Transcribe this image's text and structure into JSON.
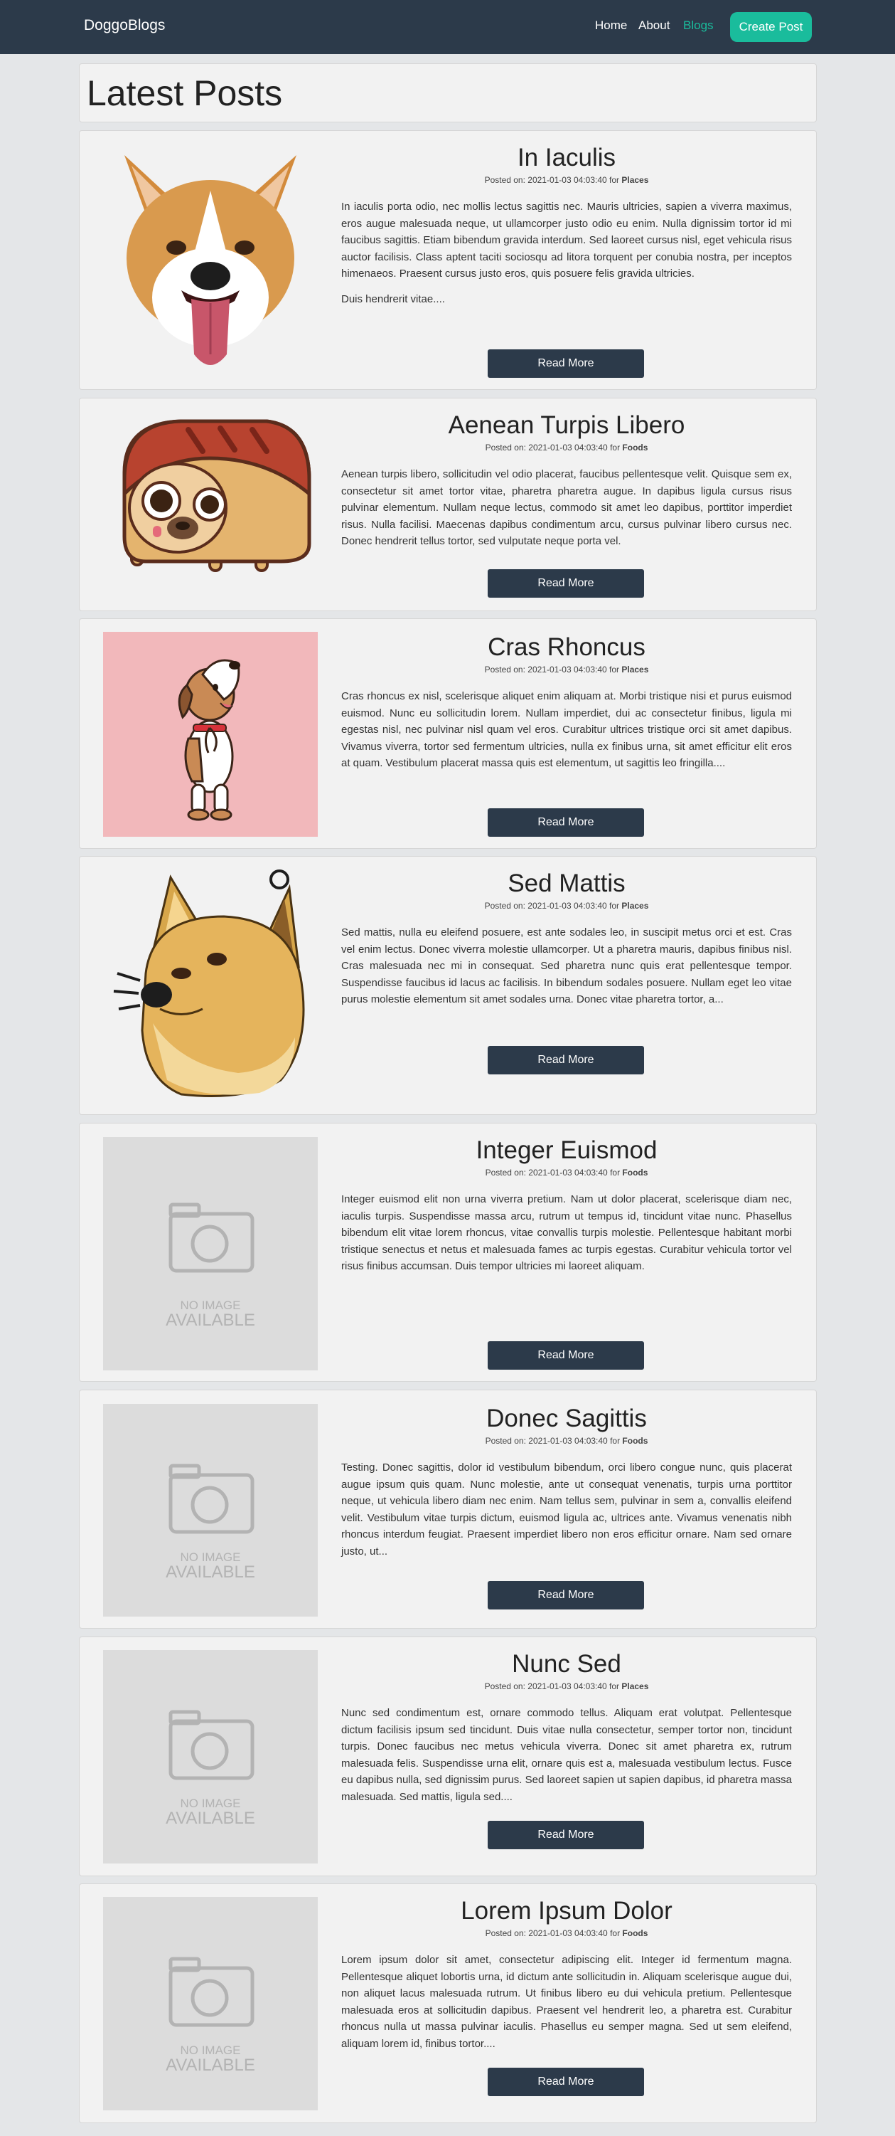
{
  "nav": {
    "brand": "DoggoBlogs",
    "links": [
      "Home",
      "About",
      "Blogs"
    ],
    "create_label": "Create Post",
    "active_color": "#1abc9c"
  },
  "heading": "Latest Posts",
  "meta_prefix": "Posted on: 2021-01-03 04:03:40 for ",
  "read_more": "Read More",
  "no_image": {
    "line1": "NO IMAGE",
    "line2": "AVAILABLE"
  },
  "posts": [
    {
      "title": "In Iaculis",
      "category": "Places",
      "image": "corgi-illustration",
      "excerpt": "In iaculis porta odio, nec mollis lectus sagittis nec. Mauris ultricies, sapien a viverra maximus, eros augue malesuada neque, ut ullamcorper justo odio eu enim. Nulla dignissim tortor id mi faucibus sagittis. Etiam bibendum gravida interdum. Sed laoreet cursus nisl, eget vehicula risus auctor facilisis. Class aptent taciti sociosqu ad litora torquent per conubia nostra, per inceptos himenaeos. Praesent cursus justo eros, quis posuere felis gravida ultricies.",
      "excerpt2": "Duis hendrerit vitae...."
    },
    {
      "title": "Aenean Turpis Libero",
      "category": "Foods",
      "image": "pug-bread-illustration",
      "excerpt": "Aenean turpis libero, sollicitudin vel odio placerat, faucibus pellentesque velit. Quisque sem ex, consectetur sit amet tortor vitae, pharetra pharetra augue. In dapibus ligula cursus risus pulvinar elementum. Nullam neque lectus, commodo sit amet leo dapibus, porttitor imperdiet risus. Nulla facilisi. Maecenas dapibus condimentum arcu, cursus pulvinar libero cursus nec. Donec hendrerit tellus tortor, sed vulputate neque porta vel."
    },
    {
      "title": "Cras Rhoncus",
      "category": "Places",
      "image": "puppy-standing-illustration",
      "excerpt": "Cras rhoncus ex nisl, scelerisque aliquet enim aliquam at. Morbi tristique nisi et purus euismod euismod. Nunc eu sollicitudin lorem. Nullam imperdiet, dui ac consectetur finibus, ligula mi egestas nisl, nec pulvinar nisl quam vel eros. Curabitur ultrices tristique orci sit amet dapibus. Vivamus viverra, tortor sed fermentum ultricies, nulla ex finibus urna, sit amet efficitur elit eros at quam. Vestibulum placerat massa quis est elementum, ut sagittis leo fringilla...."
    },
    {
      "title": "Sed Mattis",
      "category": "Places",
      "image": "doge-illustration",
      "excerpt": "Sed mattis, nulla eu eleifend posuere, est ante sodales leo, in suscipit metus orci et est. Cras vel enim lectus. Donec viverra molestie ullamcorper. Ut a pharetra mauris, dapibus finibus nisl. Cras malesuada nec mi in consequat. Sed pharetra nunc quis erat pellentesque tempor. Suspendisse faucibus id lacus ac facilisis. In bibendum sodales posuere. Nullam eget leo vitae purus molestie elementum sit amet sodales urna. Donec vitae pharetra tortor, a..."
    },
    {
      "title": "Integer Euismod",
      "category": "Foods",
      "image": "no-image",
      "excerpt": "Integer euismod elit non urna viverra pretium. Nam ut dolor placerat, scelerisque diam nec, iaculis turpis. Suspendisse massa arcu, rutrum ut tempus id, tincidunt vitae nunc. Phasellus bibendum elit vitae lorem rhoncus, vitae convallis turpis molestie. Pellentesque habitant morbi tristique senectus et netus et malesuada fames ac turpis egestas. Curabitur vehicula tortor vel risus finibus accumsan. Duis tempor ultricies mi laoreet aliquam."
    },
    {
      "title": "Donec Sagittis",
      "category": "Foods",
      "image": "no-image",
      "excerpt": "Testing. Donec sagittis, dolor id vestibulum bibendum, orci libero congue nunc, quis placerat augue ipsum quis quam. Nunc molestie, ante ut consequat venenatis, turpis urna porttitor neque, ut vehicula libero diam nec enim. Nam tellus sem, pulvinar in sem a, convallis eleifend velit. Vestibulum vitae turpis dictum, euismod ligula ac, ultrices ante. Vivamus venenatis nibh rhoncus interdum feugiat. Praesent imperdiet libero non eros efficitur ornare. Nam sed ornare justo, ut..."
    },
    {
      "title": "Nunc Sed",
      "category": "Places",
      "image": "no-image",
      "excerpt": "Nunc sed condimentum est, ornare commodo tellus. Aliquam erat volutpat. Pellentesque dictum facilisis ipsum sed tincidunt. Duis vitae nulla consectetur, semper tortor non, tincidunt turpis. Donec faucibus nec metus vehicula viverra. Donec sit amet pharetra ex, rutrum malesuada felis. Suspendisse urna elit, ornare quis est a, malesuada vestibulum lectus. Fusce eu dapibus nulla, sed dignissim purus. Sed laoreet sapien ut sapien dapibus, id pharetra massa malesuada. Sed mattis, ligula sed...."
    },
    {
      "title": "Lorem Ipsum Dolor",
      "category": "Foods",
      "image": "no-image",
      "excerpt": "Lorem ipsum dolor sit amet, consectetur adipiscing elit. Integer id fermentum magna. Pellentesque aliquet lobortis urna, id dictum ante sollicitudin in. Aliquam scelerisque augue dui, non aliquet lacus malesuada rutrum. Ut finibus libero eu dui vehicula pretium. Pellentesque malesuada eros at sollicitudin dapibus. Praesent vel hendrerit leo, a pharetra est. Curabitur rhoncus nulla ut massa pulvinar iaculis. Phasellus eu semper magna. Sed ut sem eleifend, aliquam lorem id, finibus tortor...."
    }
  ]
}
